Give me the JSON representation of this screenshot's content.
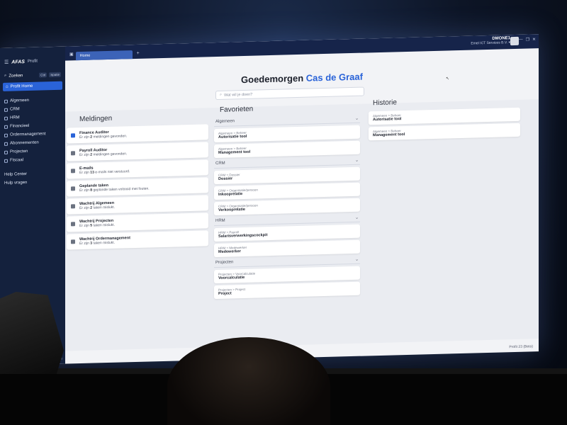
{
  "app": {
    "logo": "AFAS",
    "product": "Profit"
  },
  "sidebar": {
    "search_label": "Zoeken",
    "shortcut_ctrl": "Ctrl",
    "shortcut_key": "Spatie",
    "home_label": "Profit Home",
    "items": [
      {
        "label": "Algemeen"
      },
      {
        "label": "CRM"
      },
      {
        "label": "HRM"
      },
      {
        "label": "Financieel"
      },
      {
        "label": "Ordermanagement"
      },
      {
        "label": "Abonnementen"
      },
      {
        "label": "Projecten"
      },
      {
        "label": "Fiscaal"
      }
    ],
    "help_center": "Help Center",
    "help_questions": "Hulp vragen"
  },
  "topbar": {
    "tab_label": "Home",
    "add_tab": "+",
    "user_name": "DMONE1",
    "user_company": "Emel ICT Services B.V. ▾",
    "win_minimize": "—",
    "win_restore": "❐",
    "win_close": "✕"
  },
  "greeting": {
    "prefix": "Goedemorgen",
    "name": "Cas de Graaf"
  },
  "search": {
    "placeholder": "Wat wil je doen?"
  },
  "meldingen": {
    "title": "Meldingen",
    "items": [
      {
        "title": "Finance Auditor",
        "pre": "Er zijn",
        "count": "2",
        "post": "meldingen gevonden.",
        "accent": true
      },
      {
        "title": "Payroll Auditor",
        "pre": "Er zijn",
        "count": "2",
        "post": "meldingen gevonden.",
        "accent": false
      },
      {
        "title": "E-mails",
        "pre": "Er zijn",
        "count": "13",
        "post": "e-mails niet verstuurd.",
        "accent": false
      },
      {
        "title": "Geplande taken",
        "pre": "Er zijn",
        "count": "8",
        "post": "geplande taken voltooid met fouten.",
        "accent": false
      },
      {
        "title": "Wachtrij Algemeen",
        "pre": "Er zijn",
        "count": "2",
        "post": "taken mislukt.",
        "accent": false
      },
      {
        "title": "Wachtrij Projecten",
        "pre": "Er zijn",
        "count": "5",
        "post": "taken mislukt.",
        "accent": false
      },
      {
        "title": "Wachtrij Ordermanagement",
        "pre": "Er zijn",
        "count": "3",
        "post": "taken mislukt.",
        "accent": false
      }
    ]
  },
  "favorieten": {
    "title": "Favorieten",
    "groups": [
      {
        "name": "Algemeen",
        "items": [
          {
            "crumb_a": "Algemeen",
            "crumb_b": "Beheer",
            "title": "Autorisatie tool"
          },
          {
            "crumb_a": "Algemeen",
            "crumb_b": "Beheer",
            "title": "Management tool"
          }
        ]
      },
      {
        "name": "CRM",
        "items": [
          {
            "crumb_a": "CRM",
            "crumb_b": "Dossier",
            "title": "Dossier"
          },
          {
            "crumb_a": "CRM",
            "crumb_b": "Organisatie/persoon",
            "title": "Inkooprelatie"
          },
          {
            "crumb_a": "CRM",
            "crumb_b": "Organisatie/persoon",
            "title": "Verkooprelatie"
          }
        ]
      },
      {
        "name": "HRM",
        "items": [
          {
            "crumb_a": "HRM",
            "crumb_b": "Payroll",
            "title": "Salarisverwerkingscockpit"
          },
          {
            "crumb_a": "HRM",
            "crumb_b": "Medewerker",
            "title": "Medewerker"
          }
        ]
      },
      {
        "name": "Projecten",
        "items": [
          {
            "crumb_a": "Projecten",
            "crumb_b": "Voorcalculatie",
            "title": "Voorcalculatie"
          },
          {
            "crumb_a": "Projecten",
            "crumb_b": "Project",
            "title": "Project"
          }
        ]
      }
    ]
  },
  "historie": {
    "title": "Historie",
    "items": [
      {
        "crumb_a": "Algemeen",
        "crumb_b": "Beheer",
        "title": "Autorisatie tool"
      },
      {
        "crumb_a": "Algemeen",
        "crumb_b": "Beheer",
        "title": "Management tool"
      }
    ]
  },
  "footer": {
    "left": "e",
    "version": "Profit 23 (Beta)"
  },
  "colors": {
    "accent": "#2a63d8",
    "sidebar": "#14213d"
  }
}
